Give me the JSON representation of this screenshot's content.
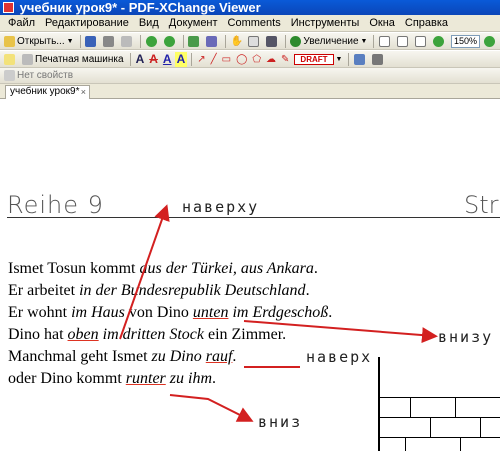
{
  "window": {
    "title": "учебник урок9* - PDF-XChange Viewer"
  },
  "menu": [
    "Файл",
    "Редактирование",
    "Вид",
    "Документ",
    "Comments",
    "Инструменты",
    "Окна",
    "Справка"
  ],
  "toolbar": {
    "open_label": "Открыть...",
    "zoom_label": "Увеличение",
    "zoom_value": "150%",
    "typewriter_label": "Печатная машинка",
    "draft_stamp": "DRAFT",
    "properties_label": "Нет свойств"
  },
  "tab": {
    "label": "учебник урок9*",
    "close": "×"
  },
  "document": {
    "heading": "Reihe 9",
    "heading_right": "Str",
    "lines": [
      {
        "a": "Ismet Tosun kommt ",
        "b": "aus der Türkei, aus Ankara",
        "c": "."
      },
      {
        "a": "Er arbeitet ",
        "b": "in der Bundesrepublik Deutschland",
        "c": "."
      },
      {
        "a": "Er wohnt ",
        "b": "im Haus",
        "c": " von Dino ",
        "d": "unten",
        "e": " im Erdgeschoß",
        "f": "."
      },
      {
        "a": "Dino hat ",
        "b": "oben",
        "c": " im dritten Stock",
        "d": " ein Zimmer."
      },
      {
        "a": "Manchmal geht Ismet ",
        "b": "zu Dino ",
        "c": "rauf",
        "d": "."
      },
      {
        "a": "oder Dino kommt ",
        "b": "runter",
        "c": " zu ihm",
        "d": "."
      }
    ],
    "notes": {
      "up1": "наверху",
      "down1": "внизу",
      "up2": "наверх",
      "down2": "вниз"
    }
  },
  "colors": {
    "titlebar": "#0b4fc8",
    "annotation": "#d32020"
  }
}
